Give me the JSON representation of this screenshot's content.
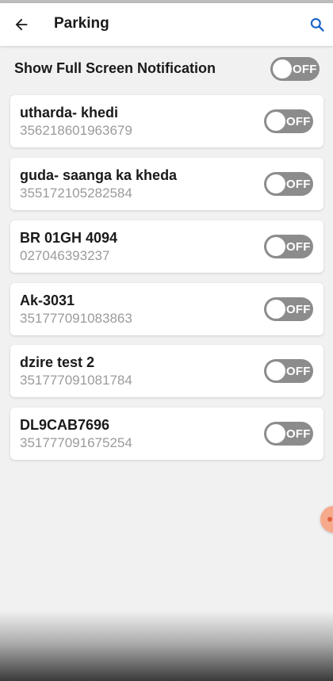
{
  "appbar": {
    "title": "Parking",
    "back_icon": "arrow-left-icon",
    "search_icon": "search-icon",
    "accent_color": "#1a66c9"
  },
  "notification": {
    "label": "Show Full Screen Notification",
    "toggle_state": "OFF"
  },
  "vehicles": [
    {
      "name": "utharda- khedi",
      "id": "356218601963679",
      "toggle_state": "OFF"
    },
    {
      "name": "guda- saanga ka kheda",
      "id": "355172105282584",
      "toggle_state": "OFF"
    },
    {
      "name": "BR 01GH 4094",
      "id": "027046393237",
      "toggle_state": "OFF"
    },
    {
      "name": "Ak-3031",
      "id": "351777091083863",
      "toggle_state": "OFF"
    },
    {
      "name": "dzire test 2",
      "id": "351777091081784",
      "toggle_state": "OFF"
    },
    {
      "name": "DL9CAB7696",
      "id": "351777091675254",
      "toggle_state": "OFF"
    }
  ],
  "colors": {
    "toggle_off": "#8c8c8c",
    "fab": "#f7a98c"
  }
}
